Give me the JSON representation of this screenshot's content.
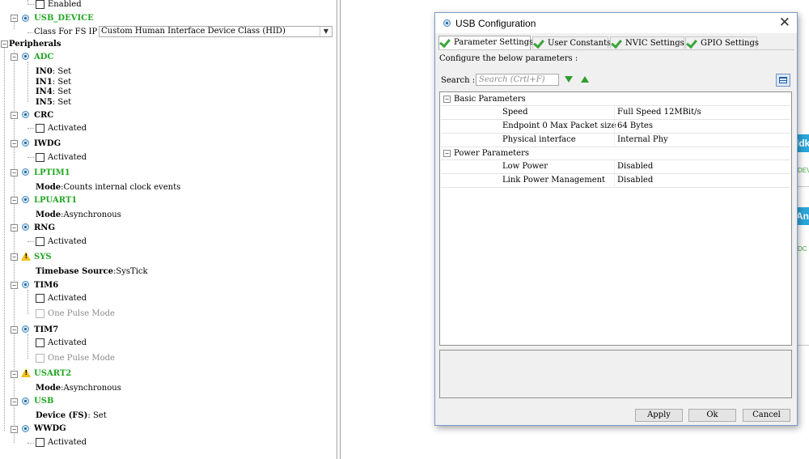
{
  "tree": {
    "top_enabled": "Enabled",
    "usb_device": "USB_DEVICE",
    "class_for_fs_ip_label": "Class For FS IP",
    "class_for_fs_ip_value": "Custom Human Interface Device Class (HID)",
    "peripherals": "Peripherals",
    "adc": "ADC",
    "adc_in0": "IN0",
    "adc_in1": "IN1",
    "adc_in4": "IN4",
    "adc_in5": "IN5",
    "set": "Set",
    "crc": "CRC",
    "activated": "Activated",
    "iwdg": "IWDG",
    "lptim1": "LPTIM1",
    "mode_label": "Mode",
    "lptim1_mode": "Counts internal clock events",
    "lpuart1": "LPUART1",
    "asynchronous": "Asynchronous",
    "rng": "RNG",
    "sys": "SYS",
    "timebase_label": "Timebase Source",
    "timebase_value": "SysTick",
    "tim6": "TIM6",
    "one_pulse_mode": "One Pulse Mode",
    "tim7": "TIM7",
    "usart2": "USART2",
    "usb": "USB",
    "device_fs_label": "Device (FS)",
    "wwdg": "WWDG"
  },
  "background": {
    "btn1_text": "ldk",
    "text1": "DEV",
    "btn2_text": "Ana",
    "text2": "DC V"
  },
  "dialog": {
    "title": "USB Configuration",
    "close_glyph": "✕",
    "tabs": [
      "Parameter Settings",
      "User Constants",
      "NVIC Settings",
      "GPIO Settings"
    ],
    "configure_label": "Configure the below parameters :",
    "search_label": "Search :",
    "search_placeholder": "Search (Crtl+F)",
    "groups": {
      "basic": "Basic Parameters",
      "power": "Power Parameters"
    },
    "params": [
      {
        "name": "Speed",
        "value": "Full Speed 12MBit/s"
      },
      {
        "name": "Endpoint 0 Max Packet size",
        "value": "64 Bytes"
      },
      {
        "name": "Physical interface",
        "value": "Internal Phy"
      },
      {
        "name": "Low Power",
        "value": "Disabled"
      },
      {
        "name": "Link Power Management",
        "value": "Disabled"
      }
    ],
    "buttons": {
      "apply": "Apply",
      "ok": "Ok",
      "cancel": "Cancel"
    }
  },
  "colors": {
    "green_label": "#22a722",
    "accent": "#2aa6d8",
    "warning": "#f1c21b"
  }
}
